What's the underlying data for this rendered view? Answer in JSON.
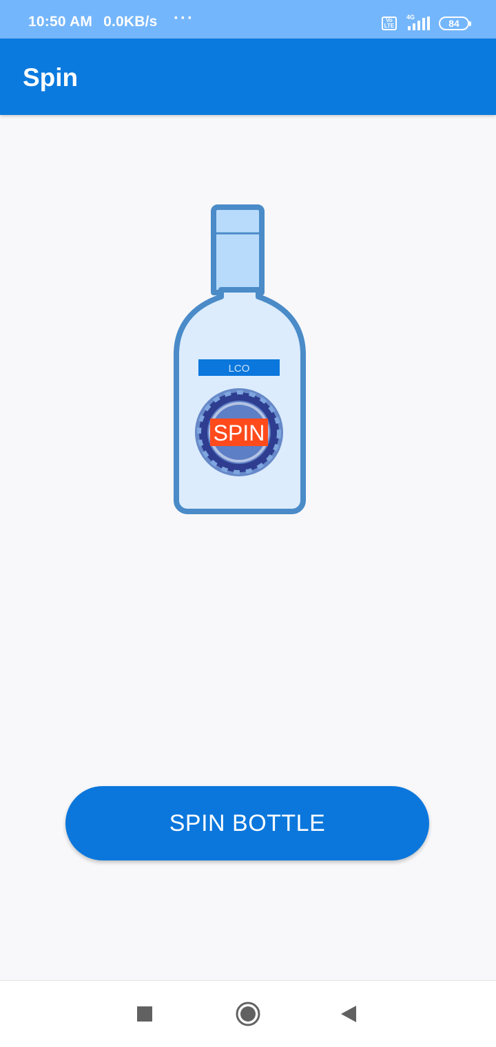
{
  "status_bar": {
    "time": "10:50 AM",
    "speed": "0.0KB/s",
    "dots": "···",
    "volte": "Vo LTE",
    "network": "4G",
    "battery": "84"
  },
  "app_bar": {
    "title": "Spin"
  },
  "bottle": {
    "label_text": "LCO",
    "badge_text": "SPIN",
    "colors": {
      "outline": "#4a8bc8",
      "body": "#dcecfc",
      "neck": "#b9dbfb",
      "label_band": "#0b77dc",
      "badge_red": "#ff4a1c",
      "badge_navy": "#2e3d8f"
    }
  },
  "spin_button": {
    "label": "SPIN BOTTLE"
  },
  "colors": {
    "primary": "#0b7ade",
    "status_bar": "#74b6fb",
    "background": "#f8f8fa"
  },
  "nav_bar": {
    "icons": [
      "recents-icon",
      "home-icon",
      "back-icon"
    ]
  }
}
